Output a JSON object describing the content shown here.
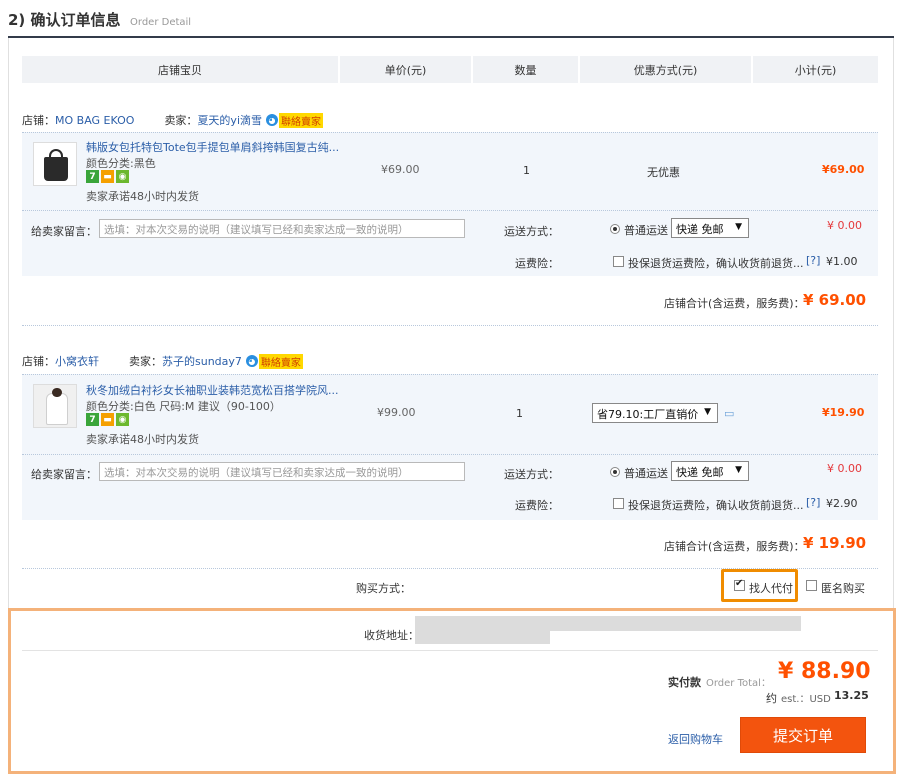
{
  "header": {
    "title": "2) 确认订单信息",
    "subtitle": "Order Detail"
  },
  "columns": [
    "店铺宝贝",
    "单价(元)",
    "数量",
    "优惠方式(元)",
    "小计(元)"
  ],
  "labels": {
    "store": "店铺：",
    "seller": "卖家：",
    "message": "给卖家留言：",
    "message_placeholder": "选填：对本次交易的说明（建议填写已经和卖家达成一致的说明）",
    "shipping": "运送方式：",
    "shipping_option": "普通运送",
    "insurance": "运费险：",
    "insurance_text": "投保退货运费险，确认收货前退货...",
    "help": "[?]",
    "store_total": "店铺合计(含运费，服务费)：",
    "wangwang_tag": "聯絡賣家",
    "ship_promise": "卖家承诺48小时内发货"
  },
  "orders": [
    {
      "store": "MO BAG EKOO",
      "seller": "夏天的yi滴雪",
      "item_title": "韩版女包托特包Tote包手提包单肩斜挎韩国复古纯...",
      "attr": "颜色分类:黑色",
      "price": "¥69.00",
      "qty": "1",
      "discount_text": "无优惠",
      "subtotal": "¥69.00",
      "shipping_select": "快递 免邮",
      "shipping_cost": "¥ 0.00",
      "insurance_cost": "¥1.00",
      "store_total": "¥ 69.00"
    },
    {
      "store": "小窝衣轩",
      "seller": "苏子的sunday7",
      "item_title": "秋冬加绒白衬衫女长袖职业装韩范宽松百搭学院风...",
      "attr": "颜色分类:白色   尺码:M 建议（90-100）",
      "price": "¥99.00",
      "qty": "1",
      "discount_select": "省79.10:工厂直销价",
      "subtotal": "¥19.90",
      "shipping_select": "快递 免邮",
      "shipping_cost": "¥ 0.00",
      "insurance_cost": "¥2.90",
      "store_total": "¥ 19.90"
    }
  ],
  "purchase": {
    "label": "购买方式：",
    "agent_pay": "找人代付",
    "anonymous": "匿名购买",
    "agent_checked": true
  },
  "summary": {
    "address_label": "收货地址：",
    "total_label": "实付款",
    "total_label_en": "Order Total：",
    "total_value": "¥ 88.90",
    "est_label": "约",
    "est_en": "est.：USD",
    "est_value": "13.25",
    "back_link": "返回购物车",
    "submit": "提交订单"
  },
  "colors": {
    "accent": "#f3540e",
    "price_red": "#ff5000",
    "link": "#2b5ea8",
    "highlight": "#f08c00"
  }
}
